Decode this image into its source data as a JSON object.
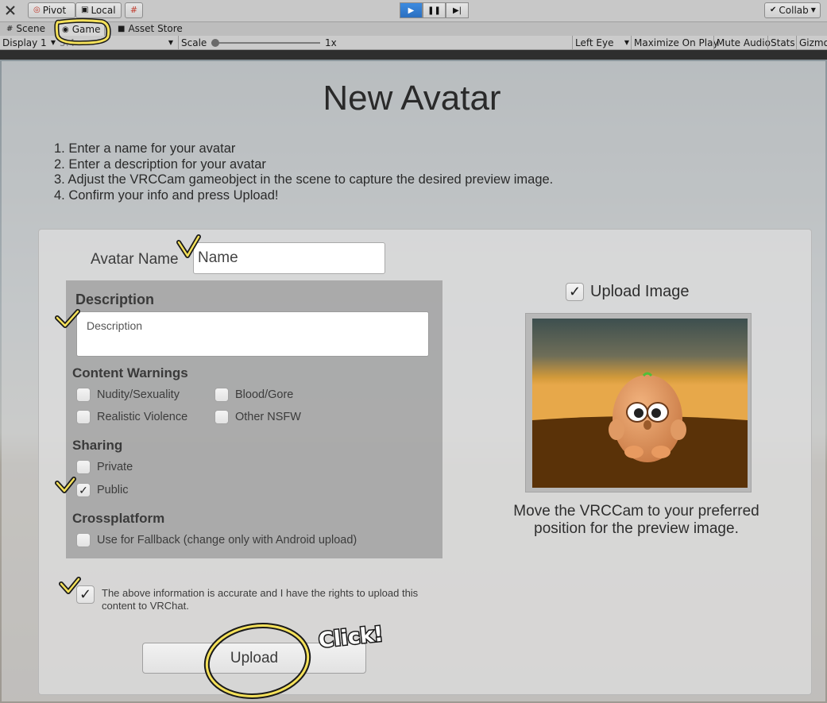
{
  "toolbar": {
    "pivot_label": "Pivot",
    "local_label": "Local",
    "collab_label": "Collab"
  },
  "tabs": [
    {
      "label": "Scene"
    },
    {
      "label": "Game"
    },
    {
      "label": "Asset Store"
    }
  ],
  "game_bar": {
    "display": "Display 1",
    "resolution": "5:4",
    "scale_label": "Scale",
    "scale_value": "1x",
    "eye": "Left Eye",
    "maximize_on_play": "Maximize On Play",
    "mute_audio": "Mute Audio",
    "stats": "Stats",
    "gizmos": "Gizmo"
  },
  "form": {
    "title": "New Avatar",
    "steps": [
      "1. Enter a name for your avatar",
      "2. Enter a description for your avatar",
      "3. Adjust the VRCCam gameobject in the scene to capture the desired preview image.",
      "4. Confirm your info and press Upload!"
    ],
    "name_label": "Avatar Name",
    "name_placeholder": "Name",
    "description_heading": "Description",
    "description_placeholder": "Description",
    "content_warnings_heading": "Content Warnings",
    "content_warnings": [
      {
        "label": "Nudity/Sexuality",
        "checked": false
      },
      {
        "label": "Blood/Gore",
        "checked": false
      },
      {
        "label": "Realistic Violence",
        "checked": false
      },
      {
        "label": "Other NSFW",
        "checked": false
      }
    ],
    "sharing_heading": "Sharing",
    "sharing": [
      {
        "label": "Private",
        "checked": false
      },
      {
        "label": "Public",
        "checked": true
      }
    ],
    "crossplatform_heading": "Crossplatform",
    "fallback_label": "Use for Fallback (change only with Android upload)",
    "fallback_checked": false,
    "upload_image_label": "Upload Image",
    "upload_image_checked": true,
    "preview_caption": "Move the VRCCam to your preferred position for the preview image.",
    "agreement_text": "The above information is accurate and I have the rights to upload this content to VRChat.",
    "agreement_checked": true,
    "upload_button": "Upload"
  },
  "annotation": {
    "click_text": "Click!"
  },
  "colors": {
    "play_active": "#2b6fc0",
    "highlight_outline": "#f5e15a"
  }
}
